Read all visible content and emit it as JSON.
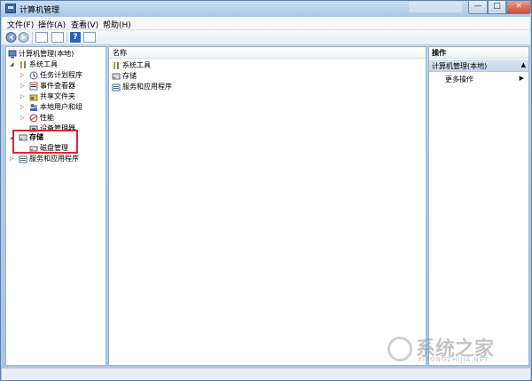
{
  "window": {
    "title": "计算机管理",
    "controls": {
      "minimize": "—",
      "maximize": "□",
      "close": "✕"
    }
  },
  "menu": [
    "文件(F)",
    "操作(A)",
    "查看(V)",
    "帮助(H)"
  ],
  "toolbar": {
    "back_icon": "arrow-left-icon",
    "forward_icon": "arrow-right-icon",
    "help": "?"
  },
  "tree": {
    "root": "计算机管理(本地)",
    "system_tools": "系统工具",
    "children": [
      {
        "label": "任务计划程序",
        "icon": "clock-icon"
      },
      {
        "label": "事件查看器",
        "icon": "event-viewer-icon"
      },
      {
        "label": "共享文件夹",
        "icon": "shared-folder-icon"
      },
      {
        "label": "本地用户和组",
        "icon": "users-icon"
      },
      {
        "label": "性能",
        "icon": "performance-icon"
      },
      {
        "label": "设备管理器",
        "icon": "device-manager-icon"
      }
    ],
    "storage": "存储",
    "disk_management": "磁盘管理",
    "services": "服务和应用程序"
  },
  "list": {
    "column_name": "名称",
    "items": [
      "系统工具",
      "存储",
      "服务和应用程序"
    ]
  },
  "actions": {
    "header": "操作",
    "section": "计算机管理(本地)",
    "more": "更多操作"
  },
  "watermark": {
    "main": "系统之家",
    "sub": "XITONGZHIJIA.NET"
  },
  "colors": {
    "highlight": "#e3222b",
    "titlebar": "#aac7e7"
  }
}
